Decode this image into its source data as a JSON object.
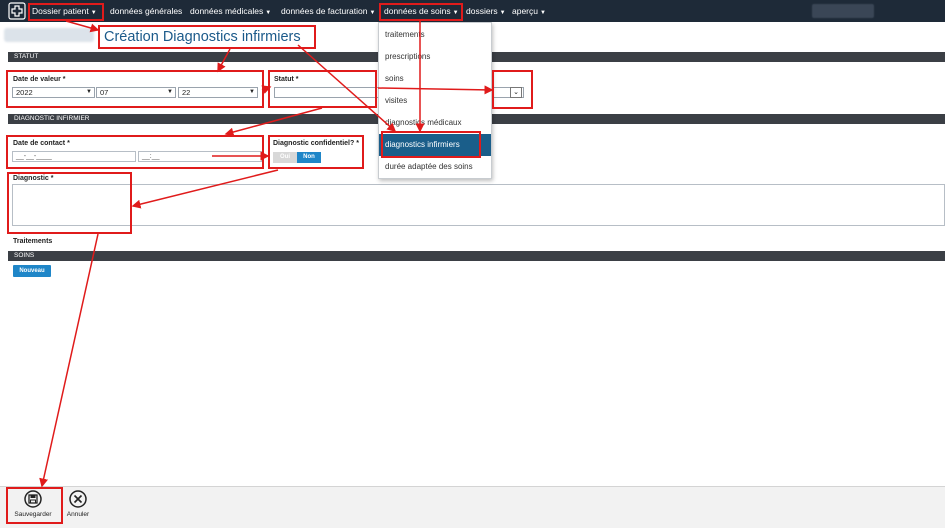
{
  "nav": {
    "dossier_patient": "Dossier patient",
    "donnees_generales": "données générales",
    "donnees_medicales": "données médicales",
    "donnees_facturation": "données de facturation",
    "donnees_soins": "données de soins",
    "dossiers": "dossiers",
    "apercu": "aperçu"
  },
  "annotation": {
    "title": "Création Diagnostics infirmiers"
  },
  "sections": {
    "statut": "STATUT",
    "diagnostic_infirmier": "DIAGNOSTIC INFIRMIER",
    "soins": "SOINS"
  },
  "form": {
    "date_valeur_label": "Date de valeur *",
    "year": "2022",
    "month": "07",
    "day": "22",
    "statut_label": "Statut *",
    "date_contact_label": "Date de contact *",
    "date_placeholder": "__-__-____",
    "time_placeholder": "__:__",
    "confidentiel_label": "Diagnostic confidentiel? *",
    "oui": "Oui",
    "non": "Non",
    "diagnostic_label": "Diagnostic *",
    "traitements_label": "Traitements",
    "nouveau": "Nouveau"
  },
  "dropdown": {
    "items": [
      "traitements",
      "prescriptions",
      "soins",
      "visites",
      "diagnostics médicaux",
      "diagnostics infirmiers",
      "durée adaptée des soins"
    ],
    "active_index": 5
  },
  "toolbar": {
    "save": "Sauvegarder",
    "cancel": "Annuler"
  },
  "colors": {
    "annotation": "#e01b1b",
    "topbar": "#1e2a38",
    "active_item": "#1a5e8a",
    "primary": "#1f86c8"
  }
}
